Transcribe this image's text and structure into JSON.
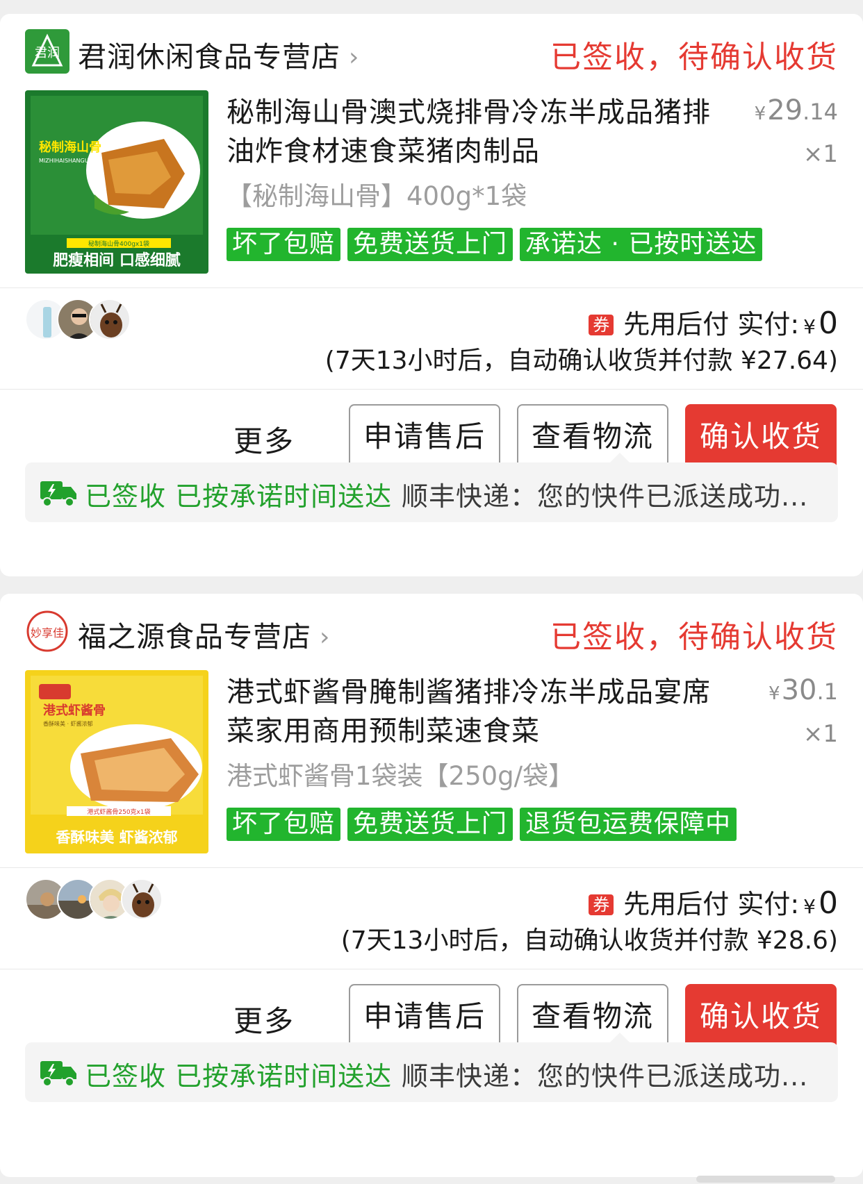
{
  "orders": [
    {
      "shop_name": "君润休闲食品专营店",
      "shop_logo_text": "君润",
      "status": "已签收，待确认收货",
      "product_title": "秘制海山骨澳式烧排骨冷冻半成品猪排油炸食材速食菜猪肉制品",
      "product_spec": "【秘制海山骨】400g*1袋",
      "price_symbol": "¥",
      "price_int": "29",
      "price_dec": ".14",
      "quantity": "×1",
      "tags": [
        "坏了包赔",
        "免费送货上门",
        "承诺达 · 已按时送达"
      ],
      "thumb_title": "秘制海山骨",
      "thumb_subtitle": "MIZHIHAISHANGU",
      "thumb_bottom": "肥瘦相间 口感细腻",
      "thumb_label": "秘制海山骨400gx1袋",
      "coupon_label": "券",
      "pay_label": "先用后付 实付:",
      "pay_amount": "0",
      "auto_confirm": "(7天13小时后，自动确认收货并付款 ¥27.64)",
      "more_label": "更多",
      "buttons": [
        "申请售后",
        "查看物流",
        "确认收货"
      ],
      "logistics_status": "已签收 已按承诺时间送达",
      "logistics_text": "顺丰快递：您的快件已派送成功..."
    },
    {
      "shop_name": "福之源食品专营店",
      "shop_logo_text": "妙享佳",
      "status": "已签收，待确认收货",
      "product_title": "港式虾酱骨腌制酱猪排冷冻半成品宴席菜家用商用预制菜速食菜",
      "product_spec": "港式虾酱骨1袋装【250g/袋】",
      "price_symbol": "¥",
      "price_int": "30",
      "price_dec": ".1",
      "quantity": "×1",
      "tags": [
        "坏了包赔",
        "免费送货上门",
        "退货包运费保障中"
      ],
      "thumb_title": "港式虾酱骨",
      "thumb_subtitle": "香酥味美 · 虾酱浓郁",
      "thumb_bottom": "香酥味美 虾酱浓郁",
      "thumb_label": "港式虾酱骨250克x1袋",
      "coupon_label": "券",
      "pay_label": "先用后付 实付:",
      "pay_amount": "0",
      "auto_confirm": "(7天13小时后，自动确认收货并付款 ¥28.6)",
      "more_label": "更多",
      "buttons": [
        "申请售后",
        "查看物流",
        "确认收货"
      ],
      "logistics_status": "已签收 已按承诺时间送达",
      "logistics_text": "顺丰快递：您的快件已派送成功..."
    }
  ],
  "colors": {
    "accent_red": "#e53a32",
    "tag_green": "#22b52e",
    "logistics_green": "#22a12c"
  }
}
